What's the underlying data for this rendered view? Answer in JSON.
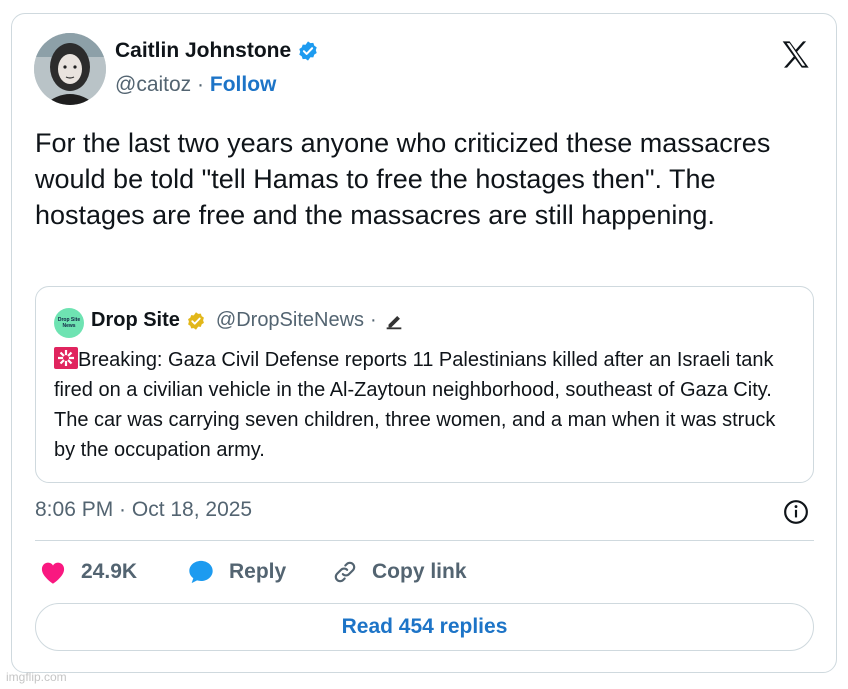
{
  "author": {
    "name": "Caitlin Johnstone",
    "handle": "@caitoz",
    "separator": "·",
    "follow_label": "Follow",
    "verified_color": "#1d9bf0"
  },
  "platform_icon": "x-logo-icon",
  "tweet_text": "For the last two years anyone who criticized these massacres would be told \"tell Hamas to free the hostages then\". The hostages are free and the massacres are still happening.",
  "quoted": {
    "name": "Drop Site",
    "handle": "@DropSiteNews",
    "separator": "·",
    "logo_text": "Drop Site News",
    "verified_color": "#e2b719",
    "text": "Breaking: Gaza Civil Defense reports 11 Palestinians killed after an Israeli tank fired on a civilian vehicle in the Al-Zaytoun neighborhood, southeast of Gaza City. The car was carrying seven children, three women, and a man when it was struck by the occupation army."
  },
  "timestamp": "8:06 PM · Oct 18, 2025",
  "actions": {
    "likes": "24.9K",
    "reply_label": "Reply",
    "copy_link_label": "Copy link"
  },
  "read_replies_label": "Read 454 replies",
  "watermark": "imgflip.com",
  "colors": {
    "accent": "#1d74c7",
    "like": "#f91880",
    "reply_icon": "#1d9bf0",
    "muted": "#536471",
    "border": "#cfd9de"
  }
}
